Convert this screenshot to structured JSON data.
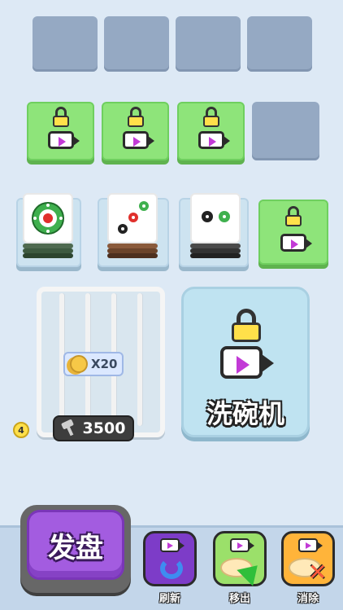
{
  "locked_slots": {
    "row2_count": 3,
    "row3_count": 1
  },
  "rack": {
    "coin_multiplier_text": "X20",
    "price_text": "3500",
    "level_badge": "4"
  },
  "machine": {
    "label": "洗碗机"
  },
  "deal_button": {
    "label": "发盘"
  },
  "tools": [
    {
      "label": "刷新",
      "icon": "refresh-icon",
      "color": "#7d3cc8"
    },
    {
      "label": "移出",
      "icon": "remove-arrow-icon",
      "color": "#9be06a"
    },
    {
      "label": "消除",
      "icon": "clear-x-icon",
      "color": "#ffb43a"
    }
  ],
  "colors": {
    "background": "#dde9f5",
    "empty_slot": "#95a9c3",
    "unlock_slot": "#8ee47a",
    "accent_purple": "#a35ce0"
  }
}
